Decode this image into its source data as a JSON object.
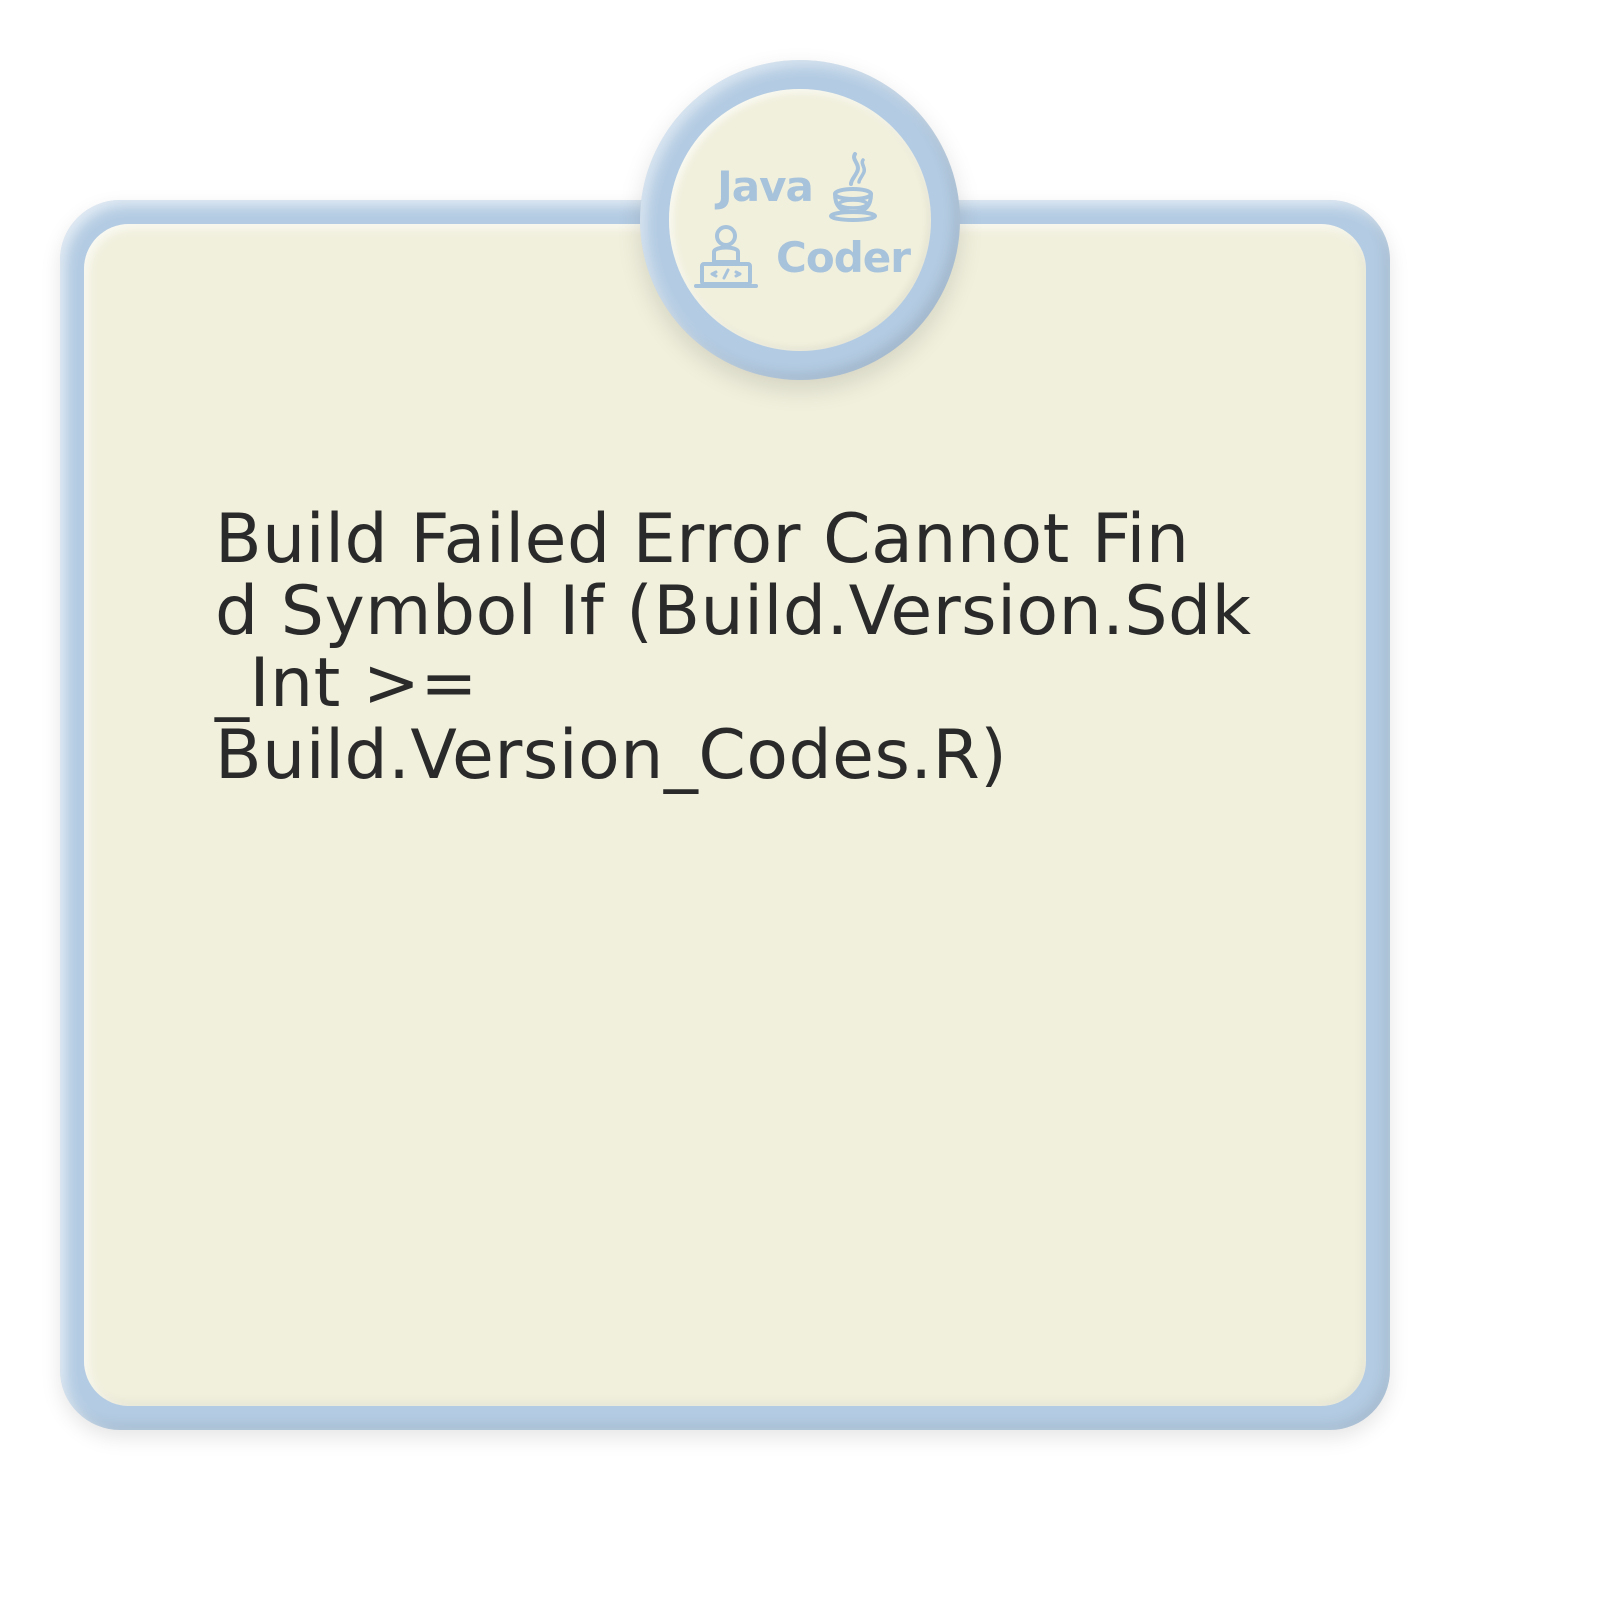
{
  "logo": {
    "java_text": "Java",
    "coder_text": "Coder"
  },
  "card": {
    "message": "Build Failed Error Cannot Fin\nd Symbol If (Build.Version.Sdk\n_Int >= Build.Version_Codes.R)"
  },
  "colors": {
    "card_border": "#b4cce3",
    "card_fill": "#f1f0dd",
    "logo_color": "#a7c2db",
    "text_color": "#2a2a2a"
  }
}
